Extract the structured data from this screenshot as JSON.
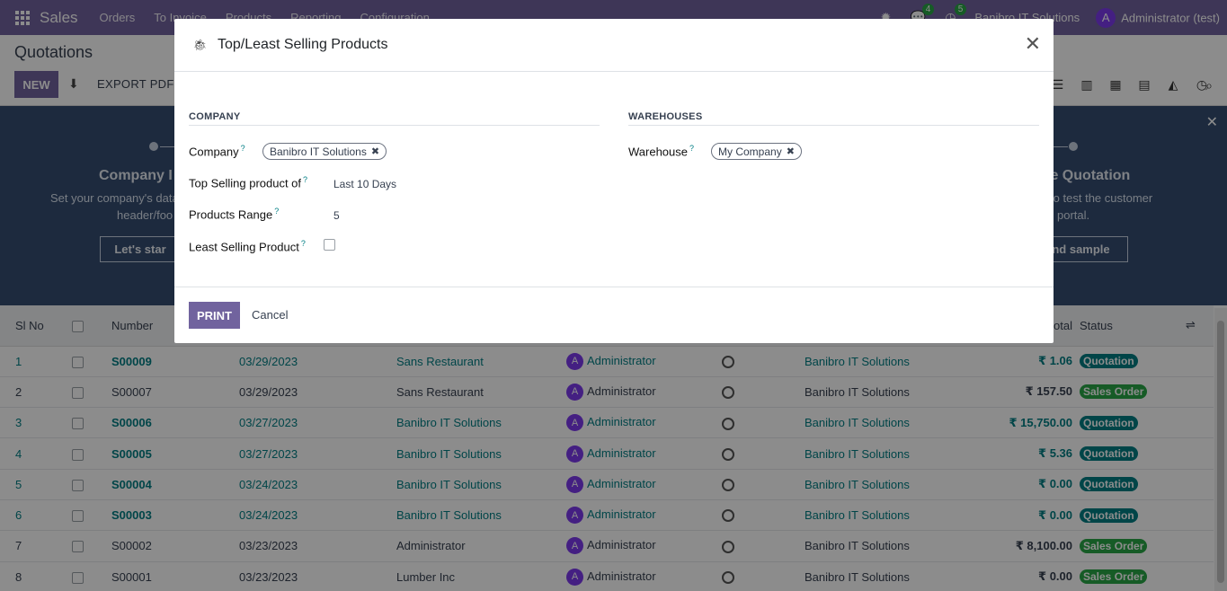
{
  "navbar": {
    "brand": "Sales",
    "menus": [
      "Orders",
      "To Invoice",
      "Products",
      "Reporting",
      "Configuration"
    ],
    "chat_count": "4",
    "activity_count": "5",
    "company": "Banibro IT Solutions",
    "user_initial": "A",
    "user": "Administrator (test)"
  },
  "control": {
    "breadcrumb": "Quotations",
    "new_label": "NEW",
    "export_label": "EXPORT PDF"
  },
  "banner": {
    "left_title": "Company I",
    "left_desc_1": "Set your company's data",
    "left_desc_2": "header/foo",
    "left_button": "Let's star",
    "right_title": "le Quotation",
    "right_desc_1": "on to test the customer",
    "right_desc_2": "portal.",
    "right_button": "nd sample"
  },
  "table": {
    "headers": {
      "sl": "Sl No",
      "number": "Number",
      "total": "otal",
      "status": "Status"
    },
    "rows": [
      {
        "sl": "1",
        "number": "S00009",
        "date": "03/29/2023",
        "customer": "Sans Restaurant",
        "salesperson": "Administrator",
        "company": "Banibro IT Solutions",
        "total": "₹ 1.06",
        "status": "Quotation",
        "linked": true
      },
      {
        "sl": "2",
        "number": "S00007",
        "date": "03/29/2023",
        "customer": "Sans Restaurant",
        "salesperson": "Administrator",
        "company": "Banibro IT Solutions",
        "total": "₹ 157.50",
        "status": "Sales Order",
        "linked": false
      },
      {
        "sl": "3",
        "number": "S00006",
        "date": "03/27/2023",
        "customer": "Banibro IT Solutions",
        "salesperson": "Administrator",
        "company": "Banibro IT Solutions",
        "total": "₹ 15,750.00",
        "status": "Quotation",
        "linked": true
      },
      {
        "sl": "4",
        "number": "S00005",
        "date": "03/27/2023",
        "customer": "Banibro IT Solutions",
        "salesperson": "Administrator",
        "company": "Banibro IT Solutions",
        "total": "₹ 5.36",
        "status": "Quotation",
        "linked": true
      },
      {
        "sl": "5",
        "number": "S00004",
        "date": "03/24/2023",
        "customer": "Banibro IT Solutions",
        "salesperson": "Administrator",
        "company": "Banibro IT Solutions",
        "total": "₹ 0.00",
        "status": "Quotation",
        "linked": true
      },
      {
        "sl": "6",
        "number": "S00003",
        "date": "03/24/2023",
        "customer": "Banibro IT Solutions",
        "salesperson": "Administrator",
        "company": "Banibro IT Solutions",
        "total": "₹ 0.00",
        "status": "Quotation",
        "linked": true
      },
      {
        "sl": "7",
        "number": "S00002",
        "date": "03/23/2023",
        "customer": "Administrator",
        "salesperson": "Administrator",
        "company": "Banibro IT Solutions",
        "total": "₹ 8,100.00",
        "status": "Sales Order",
        "linked": false
      },
      {
        "sl": "8",
        "number": "S00001",
        "date": "03/23/2023",
        "customer": "Lumber Inc",
        "salesperson": "Administrator",
        "company": "Banibro IT Solutions",
        "total": "₹ 0.00",
        "status": "Sales Order",
        "linked": false
      }
    ]
  },
  "modal": {
    "title": "Top/Least Selling Products",
    "company_section": "COMPANY",
    "warehouses_section": "WAREHOUSES",
    "company_label": "Company",
    "company_tag": "Banibro IT Solutions",
    "top_selling_label": "Top Selling product of",
    "top_selling_value": "Last 10 Days",
    "products_range_label": "Products Range",
    "products_range_value": "5",
    "least_selling_label": "Least Selling Product",
    "least_selling_checked": false,
    "warehouse_label": "Warehouse",
    "warehouse_tag": "My Company",
    "help_mark": "?",
    "print_label": "PRINT",
    "cancel_label": "Cancel"
  },
  "colors": {
    "brand": "#71639e",
    "link": "#017e84",
    "quotation": "#017e84",
    "sales_order": "#28a745"
  }
}
